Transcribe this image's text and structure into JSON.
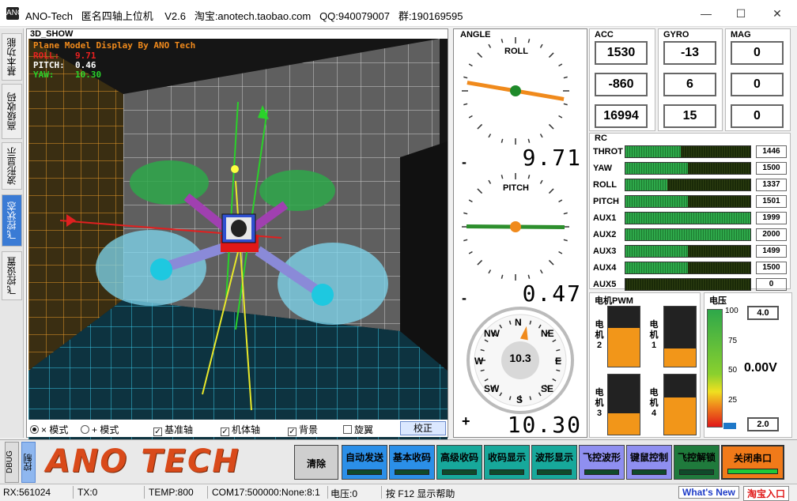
{
  "titlebar": {
    "icon": "ANO",
    "title": "ANO-Tech   匿名四轴上位机    V2.6   淘宝:anotech.taobao.com   QQ:940079007   群:190169595",
    "minimize": "—",
    "maximize": "☐",
    "close": "✕"
  },
  "lefttabs": [
    {
      "label": "基本功能"
    },
    {
      "label": "高级收码"
    },
    {
      "label": "波形显示"
    },
    {
      "label": "飞控状态"
    },
    {
      "label": "飞控设置"
    }
  ],
  "show3d": {
    "caption": "3D_SHOW",
    "hud_title": "Plane Model Display By ANO Tech",
    "roll_line": "ROLL:   9.71",
    "pitch_line": "PITCH:  0.46",
    "yaw_line": "YAW:    10.30"
  },
  "options": {
    "x_mode": "× 模式",
    "plus_mode": "+ 模式",
    "base_axis": "基准轴",
    "body_axis": "机体轴",
    "background": "背景",
    "rotor": "旋翼",
    "calibrate": "校正"
  },
  "angle": {
    "caption": "ANGLE",
    "roll_label": "ROLL",
    "roll_value": "9.71",
    "roll_deg": 9.71,
    "pitch_label": "PITCH",
    "pitch_value": "0.47",
    "pitch_deg": 0.47,
    "yaw_center": "10.3",
    "yaw_value": "10.30",
    "yaw_deg": 10.3,
    "minus": "-",
    "plus": "+",
    "compass": {
      "n": "N",
      "ne": "NE",
      "e": "E",
      "se": "SE",
      "s": "S",
      "sw": "SW",
      "w": "W",
      "nw": "NW"
    }
  },
  "sensors": {
    "acc_label": "ACC",
    "gyro_label": "GYRO",
    "mag_label": "MAG",
    "acc": [
      "1530",
      "-860",
      "16994"
    ],
    "gyro": [
      "-13",
      "6",
      "15"
    ],
    "mag": [
      "0",
      "0",
      "0"
    ]
  },
  "rc": {
    "label": "RC",
    "channels": [
      {
        "name": "THROT",
        "value": "1446",
        "level": 0.446
      },
      {
        "name": "YAW",
        "value": "1500",
        "level": 0.5
      },
      {
        "name": "ROLL",
        "value": "1337",
        "level": 0.337
      },
      {
        "name": "PITCH",
        "value": "1501",
        "level": 0.501
      },
      {
        "name": "AUX1",
        "value": "1999",
        "level": 0.999
      },
      {
        "name": "AUX2",
        "value": "2000",
        "level": 1.0
      },
      {
        "name": "AUX3",
        "value": "1499",
        "level": 0.499
      },
      {
        "name": "AUX4",
        "value": "1500",
        "level": 0.5
      },
      {
        "name": "AUX5",
        "value": "0",
        "level": 0.0
      }
    ]
  },
  "motors": {
    "label": "电机PWM",
    "m2": "电机2",
    "m1": "电机1",
    "m3": "电机3",
    "m4": "电机4",
    "levels": {
      "m2": 0.65,
      "m1": 0.3,
      "m3": 0.35,
      "m4": 0.62
    }
  },
  "voltage": {
    "label": "电压",
    "ticks": [
      "100",
      "75",
      "50",
      "25"
    ],
    "top_value": "4.0",
    "reading": "0.00V",
    "bottom_value": "2.0"
  },
  "toolbar": {
    "dbug": "DBUG",
    "ctrl": "控制",
    "logo": "ANO TECH",
    "clear": "清除",
    "auto_send": "自动发送",
    "basic_recv": "基本收码",
    "adv_recv": "高级收码",
    "code_show": "收码显示",
    "wave_show": "波形显示",
    "fc_wave": "飞控波形",
    "key_ctrl": "键鼠控制",
    "fc_unlock": "飞控解锁",
    "close_port": "关闭串口"
  },
  "status": {
    "rx": "RX:561024",
    "tx": "TX:0",
    "temp": "TEMP:800",
    "com": "COM17:500000:None:8:1",
    "volt": "电压:0",
    "help": "按 F12 显示帮助",
    "whatsnew": "What's New",
    "taobao": "淘宝入口"
  },
  "colors": {
    "roll_needle": "#f08a1c",
    "pitch_needle": "#2d8f2d",
    "accent_blue": "#3a7bd5",
    "btn_blue": "#2b8fe8",
    "btn_teal": "#17a89b",
    "btn_purple": "#8f8ff0",
    "btn_darkgreen": "#1f7a3c",
    "btn_orange": "#f07a19"
  }
}
